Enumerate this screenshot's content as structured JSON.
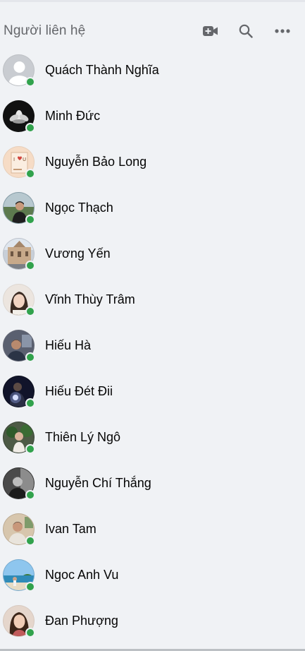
{
  "header": {
    "title": "Người liên hệ",
    "video_icon": "video-camera-plus-icon",
    "search_icon": "search-icon",
    "more_icon": "more-horizontal-icon"
  },
  "contacts": [
    {
      "name": "Quách Thành Nghĩa",
      "online": true,
      "avatar": "default-avatar"
    },
    {
      "name": "Minh Đức",
      "online": true,
      "avatar": "lotus-dark"
    },
    {
      "name": "Nguyễn Bảo Long",
      "online": true,
      "avatar": "i-love-u-card"
    },
    {
      "name": "Ngọc Thạch",
      "online": true,
      "avatar": "man-outdoor"
    },
    {
      "name": "Vương Yến",
      "online": true,
      "avatar": "building"
    },
    {
      "name": "Vĩnh Thùy Trâm",
      "online": true,
      "avatar": "woman-light"
    },
    {
      "name": "Hiếu Hà",
      "online": true,
      "avatar": "man-indoor"
    },
    {
      "name": "Hiếu Đét Đii",
      "online": true,
      "avatar": "night-light"
    },
    {
      "name": "Thiên Lý Ngô",
      "online": true,
      "avatar": "plants"
    },
    {
      "name": "Nguyễn Chí Thắng",
      "online": true,
      "avatar": "bw-portrait"
    },
    {
      "name": "Ivan Tam",
      "online": true,
      "avatar": "man-cafe"
    },
    {
      "name": "Ngoc Anh Vu",
      "online": true,
      "avatar": "beach"
    },
    {
      "name": "Đan Phượng",
      "online": true,
      "avatar": "woman-portrait"
    }
  ],
  "colors": {
    "background": "#f0f2f5",
    "online": "#31a24c",
    "text": "#050505",
    "secondary": "#65676b"
  }
}
